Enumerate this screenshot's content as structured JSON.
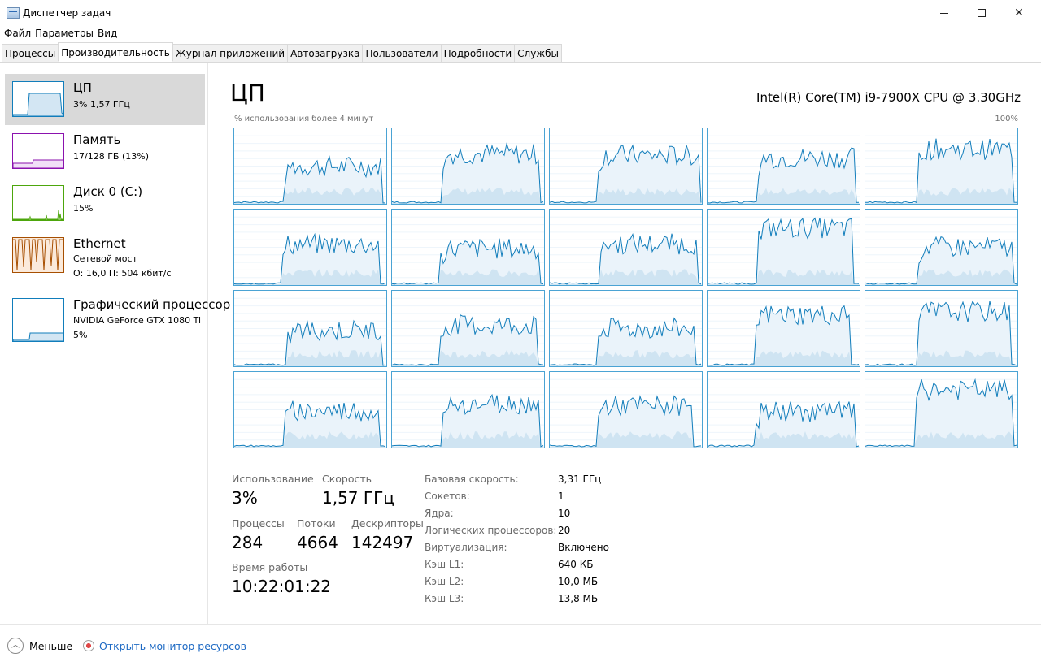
{
  "window": {
    "title": "Диспетчер задач",
    "minimize": "–",
    "maximize": "",
    "close": "✕"
  },
  "menu": [
    "Файл",
    "Параметры",
    "Вид"
  ],
  "tabs": [
    "Процессы",
    "Производительность",
    "Журнал приложений",
    "Автозагрузка",
    "Пользователи",
    "Подробности",
    "Службы"
  ],
  "active_tab": "Производительность",
  "sidebar": {
    "items": [
      {
        "title": "ЦП",
        "sub1": "3%  1,57 ГГц",
        "sub2": "",
        "color": "#117dbb"
      },
      {
        "title": "Память",
        "sub1": "17/128 ГБ (13%)",
        "sub2": "",
        "color": "#8b12ae"
      },
      {
        "title": "Диск 0 (C:)",
        "sub1": "15%",
        "sub2": "",
        "color": "#4da60c"
      },
      {
        "title": "Ethernet",
        "sub1": "Сетевой мост",
        "sub2": "О:  16,0  П:  504 кбит/с",
        "color": "#a74f01"
      },
      {
        "title": "Графический процессор",
        "sub1": "NVIDIA GeForce GTX 1080 Ti",
        "sub2": "5%",
        "color": "#117dbb"
      }
    ]
  },
  "main": {
    "title": "ЦП",
    "cpu_model": "Intel(R) Core(TM) i9-7900X CPU @ 3.30GHz",
    "graph_label": "% использования более 4 минут",
    "graph_max": "100%",
    "graph_color": "#117dbb",
    "stats": {
      "usage_label": "Использование",
      "usage_value": "3%",
      "speed_label": "Скорость",
      "speed_value": "1,57 ГГц",
      "processes_label": "Процессы",
      "processes_value": "284",
      "threads_label": "Потоки",
      "threads_value": "4664",
      "handles_label": "Дескрипторы",
      "handles_value": "142497",
      "uptime_label": "Время работы",
      "uptime_value": "10:22:01:22"
    },
    "info": [
      {
        "label": "Базовая скорость:",
        "value": "3,31 ГГц"
      },
      {
        "label": "Сокетов:",
        "value": "1"
      },
      {
        "label": "Ядра:",
        "value": "10"
      },
      {
        "label": "Логических процессоров:",
        "value": "20"
      },
      {
        "label": "Виртуализация:",
        "value": "Включено"
      },
      {
        "label": "Кэш L1:",
        "value": "640 КБ"
      },
      {
        "label": "Кэш L2:",
        "value": "10,0 МБ"
      },
      {
        "label": "Кэш L3:",
        "value": "13,8 МБ"
      }
    ]
  },
  "footer": {
    "less": "Меньше",
    "resource_monitor": "Открыть монитор ресурсов"
  }
}
